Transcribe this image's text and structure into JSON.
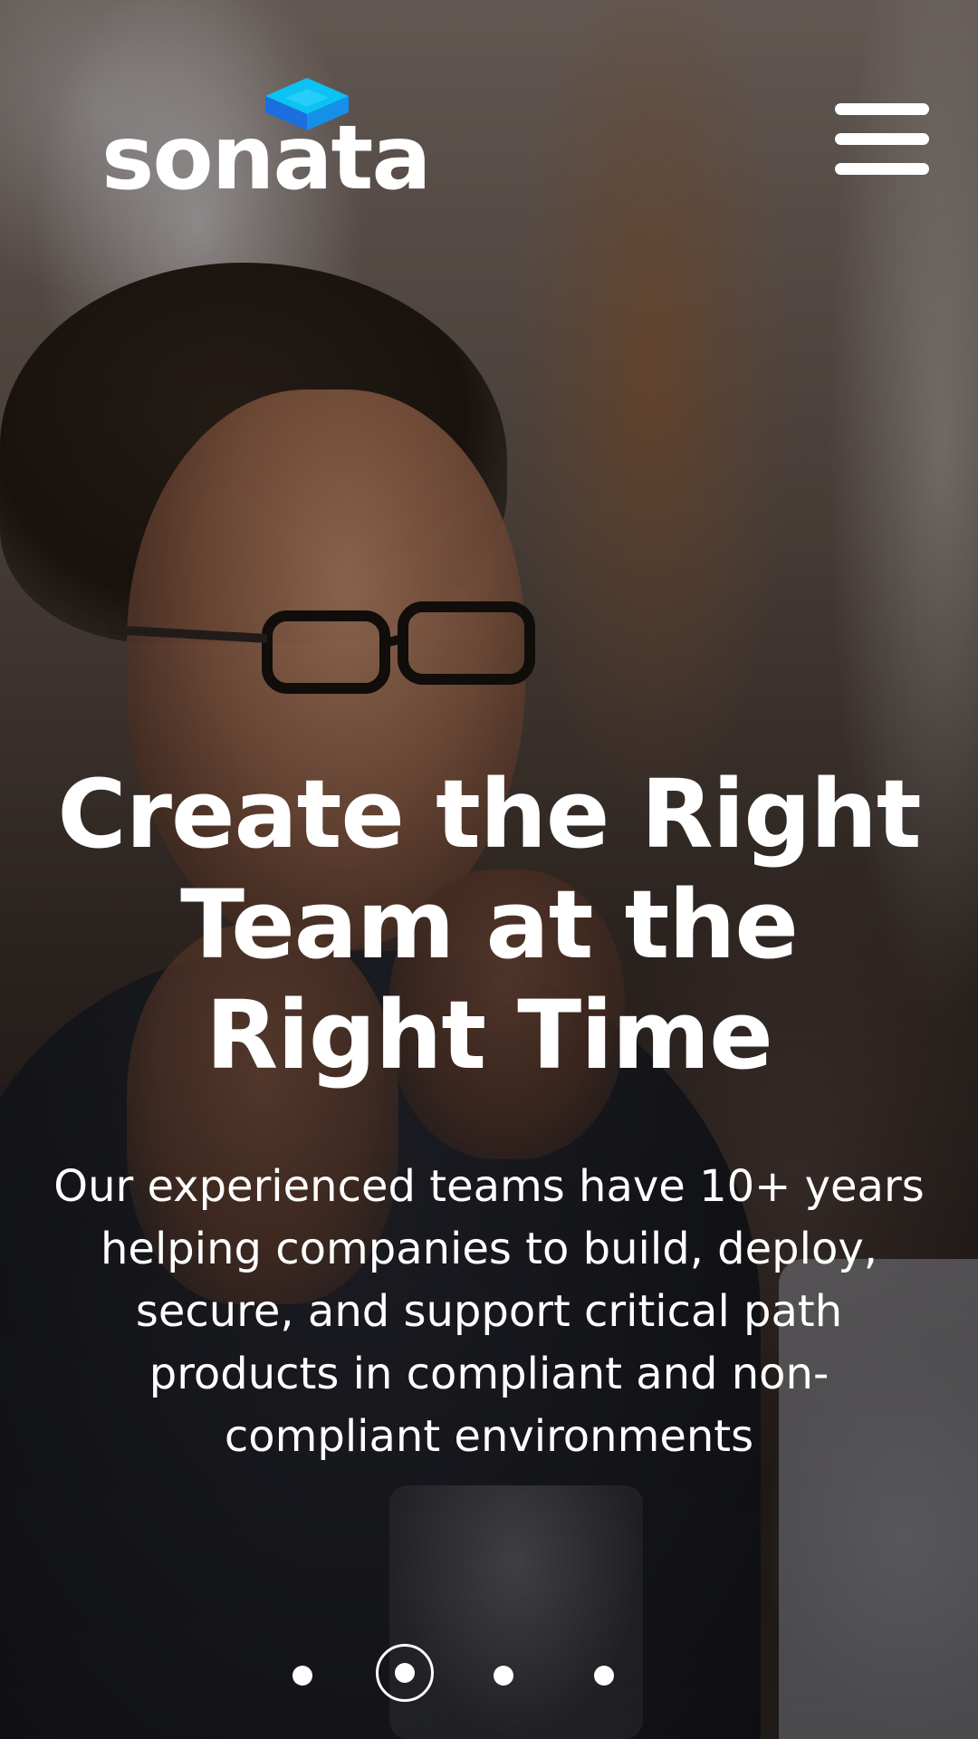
{
  "header": {
    "logo_text": "sonata",
    "logo_mark_icon": "sonata-cube-mark-icon",
    "menu_icon": "hamburger-menu-icon",
    "colors": {
      "logo_mark_top": "#0ac3f2",
      "logo_mark_side": "#1b6fe0"
    }
  },
  "hero": {
    "headline_lines": [
      "Create the Right",
      "Team at the",
      "Right Time"
    ],
    "subtext_lines": [
      "Our experienced teams have 10+ years",
      "helping companies to build, deploy,",
      "secure, and support critical path",
      "products in compliant and non-",
      "compliant environments"
    ]
  },
  "carousel": {
    "slide_count": 4,
    "active_index": 1
  }
}
